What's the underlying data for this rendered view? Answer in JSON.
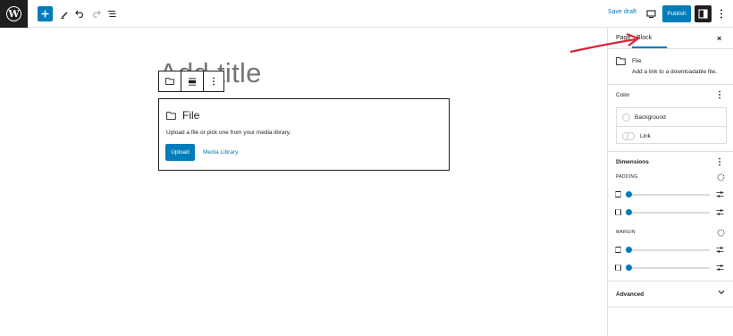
{
  "topbar": {
    "logo_letter": "W",
    "add_icon": "plus-icon",
    "tools_icon": "pen-icon",
    "undo_icon": "undo-icon",
    "redo_icon": "redo-icon",
    "outline_icon": "list-view-icon",
    "save_draft_label": "Save draft",
    "device_icon": "desktop-icon",
    "publish_label": "Publish",
    "settings_icon": "sidebar-toggle-icon",
    "more_icon": "kebab-icon",
    "accent_color": "#007cba"
  },
  "canvas": {
    "title_placeholder": "Add title",
    "block_toolbar": {
      "icons": [
        "folder-icon",
        "align-icon",
        "kebab-icon"
      ]
    },
    "file_block": {
      "title": "File",
      "description": "Upload a file or pick one from your media library.",
      "upload_label": "Upload",
      "media_library_label": "Media Library"
    }
  },
  "sidebar": {
    "tabs": [
      {
        "label": "Page",
        "active": false
      },
      {
        "label": "Block",
        "active": true
      }
    ],
    "close_label": "×",
    "block_card": {
      "name": "File",
      "description": "Add a link to a downloadable file."
    },
    "color": {
      "title": "Color",
      "items": [
        {
          "label": "Background"
        },
        {
          "label": "Link"
        }
      ]
    },
    "dimensions": {
      "title": "Dimensions",
      "padding_label": "PADDING",
      "margin_label": "MARGIN"
    },
    "advanced": {
      "title": "Advanced"
    }
  }
}
